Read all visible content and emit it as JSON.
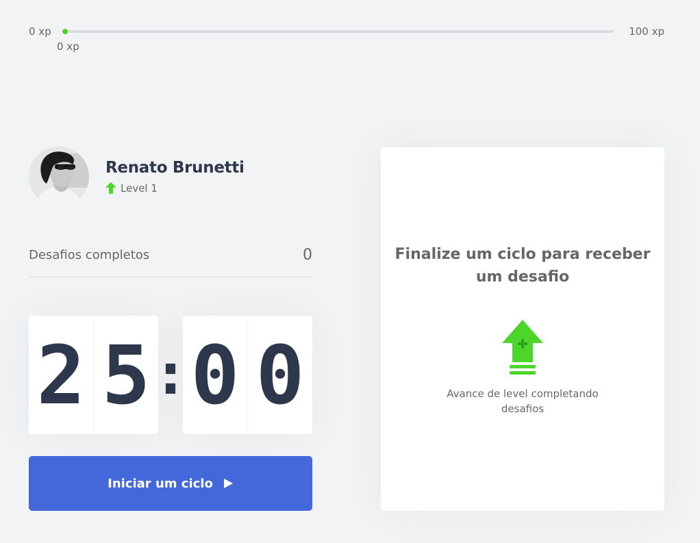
{
  "experience": {
    "min_label": "0 xp",
    "max_label": "100 xp",
    "current_label": "0 xp",
    "progress_fraction": 0
  },
  "profile": {
    "name": "Renato Brunetti",
    "level_label": "Level 1",
    "level_icon": "level-up-arrow-icon"
  },
  "completed_challenges": {
    "label": "Desafios completos",
    "count": "0"
  },
  "countdown": {
    "minute_left": "2",
    "minute_right": "5",
    "separator": ":",
    "second_left": "0",
    "second_right": "0"
  },
  "start_button": {
    "label": "Iniciar um ciclo",
    "icon": "play-icon"
  },
  "challenge_box": {
    "title": "Finalize um ciclo para receber um desafio",
    "icon": "level-up-icon",
    "hint": "Avance de level completando desafios"
  },
  "colors": {
    "background": "#f2f3f5",
    "accent_green": "#4cd62b",
    "primary_blue": "#4368d9",
    "title_dark": "#2e384d",
    "text": "#666666"
  }
}
